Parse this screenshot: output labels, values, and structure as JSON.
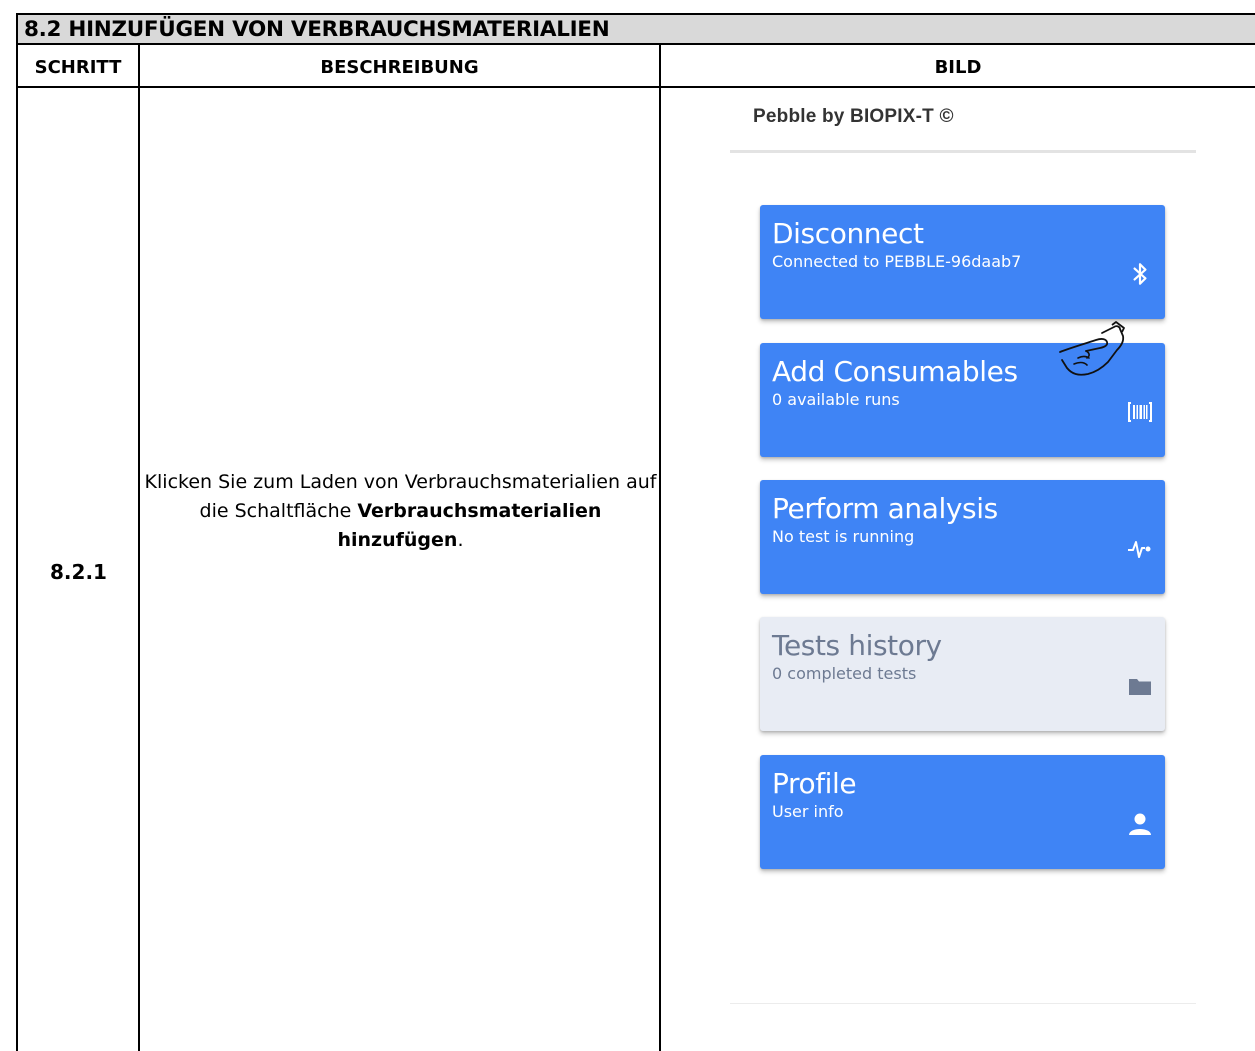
{
  "section_title": "8.2 HINZUFÜGEN VON VERBRAUCHSMATERIALIEN",
  "columns": {
    "step": "SCHRITT",
    "description": "BESCHREIBUNG",
    "image": "BILD"
  },
  "row": {
    "step": "8.2.1",
    "description_part1": "Klicken Sie zum Laden von Verbrauchsmaterialien auf die Schaltfläche",
    "description_bold": "Verbrauchsmaterialien hinzufügen",
    "description_end": "."
  },
  "app": {
    "title": "Pebble by BIOPIX-T ©",
    "cards": [
      {
        "title": "Disconnect",
        "subtitle": "Connected to PEBBLE-96daab7",
        "icon": "bluetooth-icon",
        "enabled": true
      },
      {
        "title": "Add Consumables",
        "subtitle": "0 available runs",
        "icon": "barcode-icon",
        "enabled": true
      },
      {
        "title": "Perform analysis",
        "subtitle": "No test is running",
        "icon": "pulse-icon",
        "enabled": true
      },
      {
        "title": "Tests history",
        "subtitle": "0 completed tests",
        "icon": "folder-icon",
        "enabled": false
      },
      {
        "title": "Profile",
        "subtitle": "User info",
        "icon": "person-icon",
        "enabled": true
      }
    ],
    "pointer": "hand-pointer-icon",
    "colors": {
      "card_active": "#3f84f5",
      "card_disabled": "#e8ecf4",
      "card_disabled_text": "#6d7a92"
    }
  }
}
